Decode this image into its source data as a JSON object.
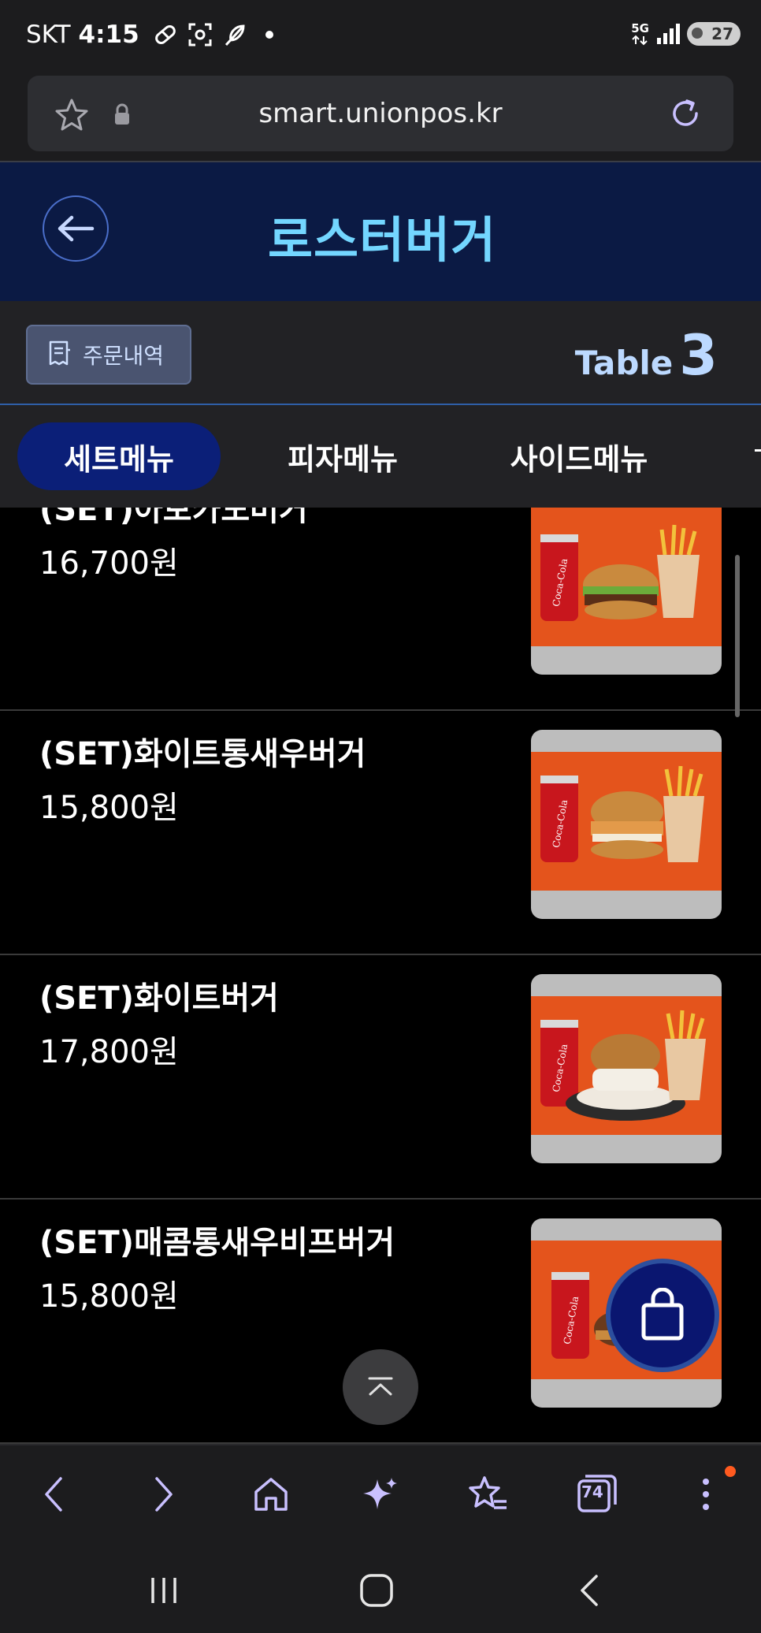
{
  "status_bar": {
    "carrier": "SKT",
    "time": "4:15",
    "network": "5G",
    "battery": "27",
    "icons": [
      "pill-icon",
      "screenshot-icon",
      "feather-icon",
      "dot-icon",
      "signal-icon",
      "battery-icon"
    ]
  },
  "browser": {
    "url": "smart.unionpos.kr",
    "icons": [
      "star-icon",
      "lock-icon",
      "reload-icon"
    ]
  },
  "header": {
    "title": "로스터버거",
    "back_icon": "arrow-left-icon"
  },
  "info": {
    "order_history_label": "주문내역",
    "table_label": "Table",
    "table_number": "3"
  },
  "tabs": [
    {
      "label": "세트메뉴",
      "active": true
    },
    {
      "label": "피자메뉴",
      "active": false
    },
    {
      "label": "사이드메뉴",
      "active": false
    }
  ],
  "menu_items": [
    {
      "name": "(SET)아보카도버거",
      "price": "16,700원"
    },
    {
      "name": "(SET)화이트통새우버거",
      "price": "15,800원"
    },
    {
      "name": "(SET)화이트버거",
      "price": "17,800원"
    },
    {
      "name": "(SET)매콤통새우비프버거",
      "price": "15,800원"
    }
  ],
  "colors": {
    "header_bg": "#0b1a44",
    "title": "#73d6ff",
    "active_tab": "#0b1f78",
    "photo_bg": "#e4541c",
    "notif": "#ff5a1f"
  },
  "toolbar": {
    "tabs_count": "74",
    "icons": [
      "back-icon",
      "forward-icon",
      "home-icon",
      "sparkle-icon",
      "bookmarks-icon",
      "tabs-icon",
      "more-icon"
    ]
  }
}
